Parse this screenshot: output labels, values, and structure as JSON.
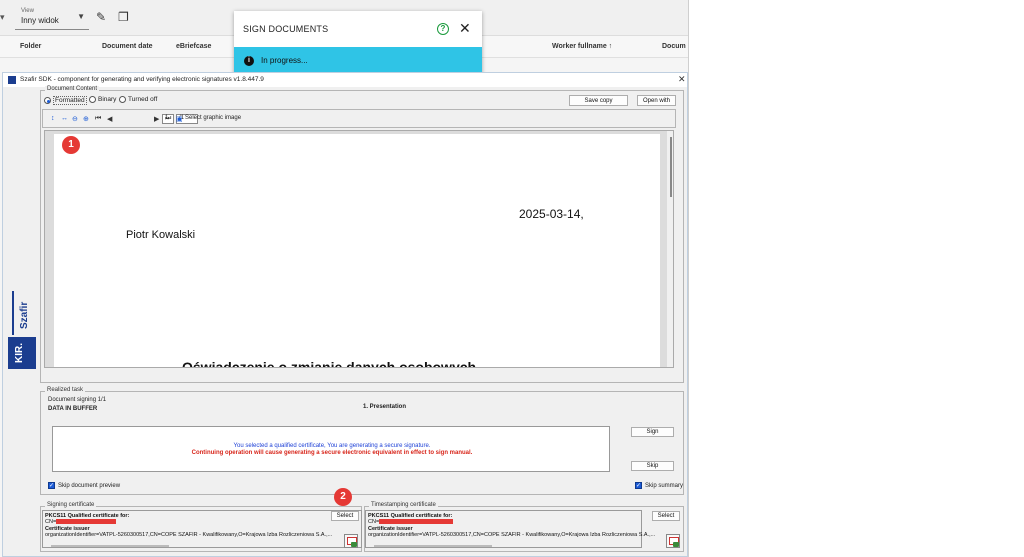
{
  "background_app": {
    "view_small_label": "View",
    "view_value": "Inny widok",
    "columns": [
      "Folder",
      "Document date",
      "eBriefcase",
      "Worker fullname ↑",
      "Docum"
    ]
  },
  "sign_dialog": {
    "title": "SIGN DOCUMENTS",
    "status": "In progress..."
  },
  "szafir": {
    "title": "Szafir SDK - component for generating and verifying electronic signatures  v1.8.447.9",
    "brand_szafir": "Szafir",
    "brand_kir": "KIR.",
    "content": {
      "legend": "Document Content",
      "radio_formatted": "Formatted",
      "radio_binary": "Binary",
      "radio_turned_off": "Turned off",
      "save_copy": "Save copy",
      "open_with": "Open with",
      "page_current": "1",
      "page_total": "/1",
      "select_graphic": "Select graphic image"
    },
    "document": {
      "date": "2025-03-14,",
      "name": "Piotr Kowalski",
      "heading": "Oświadczenie o zmianie danych osobowych"
    },
    "markers": [
      "1",
      "2"
    ],
    "task": {
      "legend": "Realized task",
      "signing": "Document signing 1/1",
      "data_in_buffer": "DATA IN BUFFER",
      "step": "1. Presentation",
      "message1": "You selected a qualified certificate, You are generating a secure signature.",
      "message2": "Continuing operation will cause generating a secure electronic equivalent in effect to sign manual.",
      "sign_button": "Sign",
      "skip_button": "Skip",
      "skip_preview": "Skip document preview",
      "skip_summary": "Skip summary"
    },
    "signing_cert": {
      "legend": "Signing certificate",
      "line1": "PKCS11 Qualified certificate for:",
      "cn_prefix": "CN=",
      "issuer_label": "Certificate issuer",
      "issuer_value": "organizationIdentifier=VATPL-5260300517,CN=COPE SZAFIR - Kwalifikowany,O=Krajowa Izba Rozliczeniowa S.A.,...",
      "select_button": "Select"
    },
    "timestamp_cert": {
      "legend": "Timestamping certificate",
      "line1": "PKCS11 Qualified certificate for:",
      "cn_prefix": "CN=",
      "issuer_label": "Certificate issuer",
      "issuer_value": "organizationIdentifier=VATPL-5260300517,CN=COPE SZAFIR - Kwalifikowany,O=Krajowa Izba Rozliczeniowa S.A.,...",
      "select_button": "Select"
    }
  }
}
